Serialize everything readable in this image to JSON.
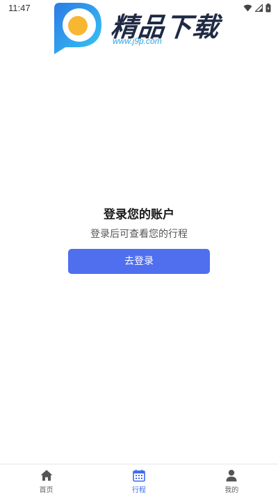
{
  "status_bar": {
    "time": "11:47"
  },
  "watermark": {
    "title": "精品下载",
    "url": "www.j9p.com"
  },
  "main": {
    "title": "登录您的账户",
    "subtitle": "登录后可查看您的行程",
    "login_button": "去登录"
  },
  "tabbar": {
    "active_color": "#3b6df0",
    "items": [
      {
        "label": "首页",
        "icon": "home-icon",
        "active": false
      },
      {
        "label": "行程",
        "icon": "calendar-icon",
        "active": true
      },
      {
        "label": "我的",
        "icon": "person-icon",
        "active": false
      }
    ]
  },
  "colors": {
    "button": "#4f6fee"
  }
}
